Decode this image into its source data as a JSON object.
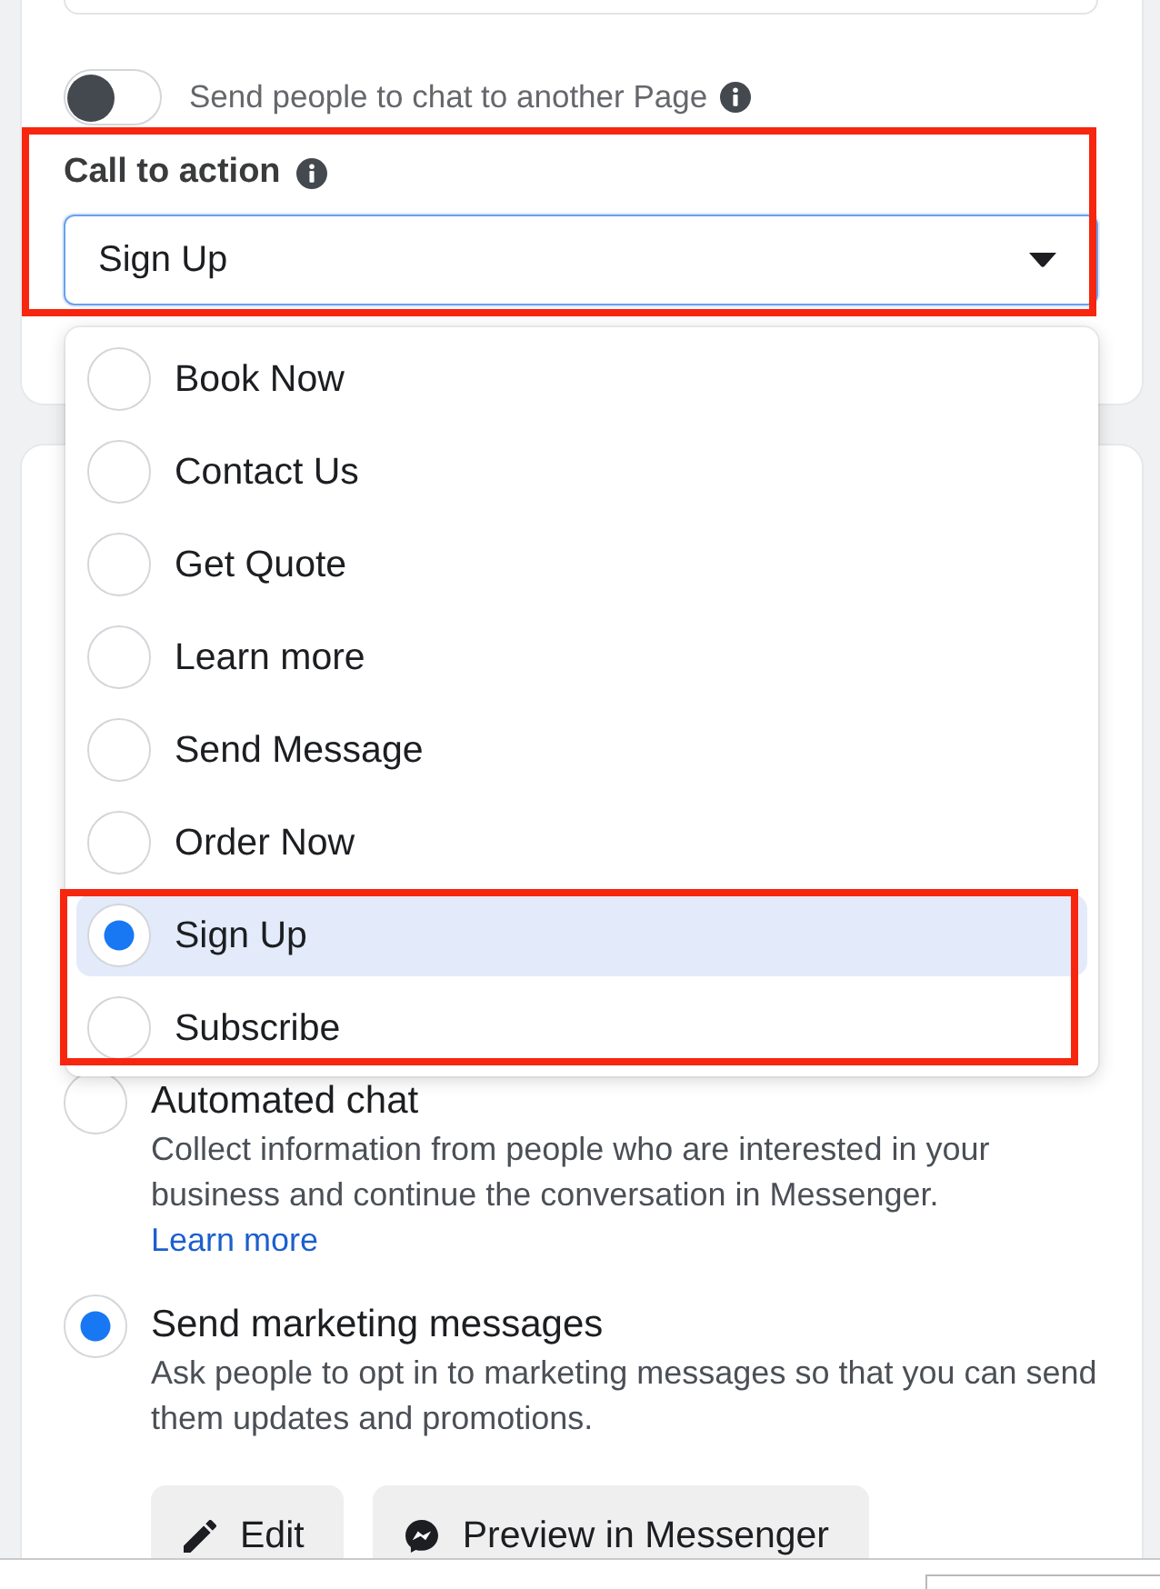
{
  "chat_toggle": {
    "label": "Send people to chat to another Page",
    "on": false
  },
  "call_to_action": {
    "label": "Call to action",
    "value": "Sign Up",
    "expanded": true,
    "highlighted": true,
    "options": [
      {
        "label": "Book Now",
        "selected": false,
        "highlighted": false
      },
      {
        "label": "Contact Us",
        "selected": false,
        "highlighted": false
      },
      {
        "label": "Get Quote",
        "selected": false,
        "highlighted": false
      },
      {
        "label": "Learn more",
        "selected": false,
        "highlighted": false
      },
      {
        "label": "Send Message",
        "selected": false,
        "highlighted": false
      },
      {
        "label": "Order Now",
        "selected": false,
        "highlighted": false
      },
      {
        "label": "Sign Up",
        "selected": true,
        "highlighted": true
      },
      {
        "label": "Subscribe",
        "selected": false,
        "highlighted": true
      }
    ]
  },
  "messaging_options": [
    {
      "title": "Automated chat",
      "description": "Collect information from people who are interested in your business and continue the conversation in Messenger.",
      "link": "Learn more",
      "selected": false
    },
    {
      "title": "Send marketing messages",
      "description": "Ask people to opt in to marketing messages so that you can send them updates and promotions.",
      "selected": true
    }
  ],
  "buttons": [
    {
      "label": "Edit",
      "kind": "edit"
    },
    {
      "label": "Preview in Messenger",
      "kind": "preview"
    }
  ]
}
